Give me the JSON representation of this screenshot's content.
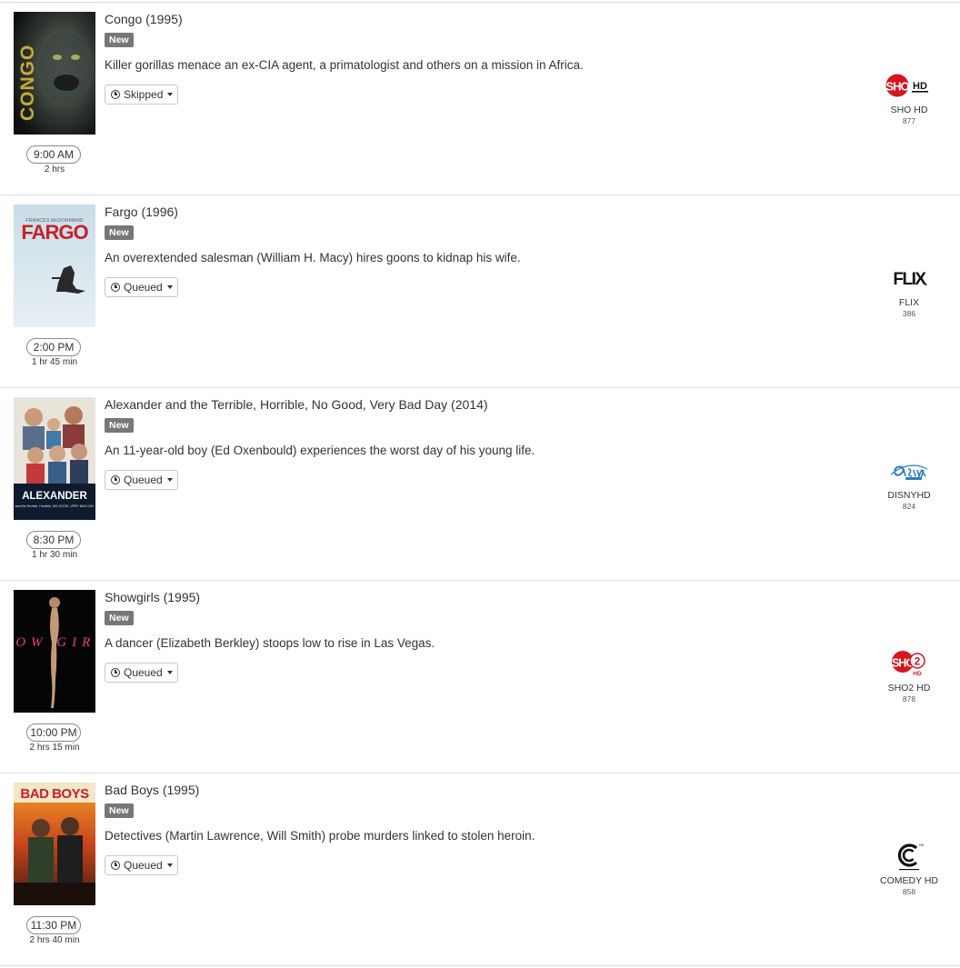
{
  "listings": [
    {
      "title": "Congo (1995)",
      "badge": "New",
      "description": "Killer gorillas menace an ex-CIA agent, a primatologist and others on a mission in Africa.",
      "status": "Skipped",
      "time": "9:00 AM",
      "duration": "2 hrs",
      "poster_text": "CONGO",
      "channel": {
        "name": "SHO HD",
        "number": "877",
        "logo": "sho-hd-logo"
      }
    },
    {
      "title": "Fargo (1996)",
      "badge": "New",
      "description": "An overextended salesman (William H. Macy) hires goons to kidnap his wife.",
      "status": "Queued",
      "time": "2:00 PM",
      "duration": "1 hr 45 min",
      "poster_text": "FARGO",
      "poster_subtext": "FRANCES McDORMAND",
      "channel": {
        "name": "FLIX",
        "number": "386",
        "logo": "flix-logo"
      }
    },
    {
      "title": "Alexander and the Terrible, Horrible, No Good, Very Bad Day (2014)",
      "badge": "New",
      "description": "An 11-year-old boy (Ed Oxenbould) experiences the worst day of his young life.",
      "status": "Queued",
      "time": "8:30 PM",
      "duration": "1 hr 30 min",
      "poster_text": "ALEXANDER",
      "poster_subtext": "and the Terrible, Horrible, NO GOOD, VERY BAD DAY",
      "channel": {
        "name": "DISNYHD",
        "number": "824",
        "logo": "disney-channel-logo"
      }
    },
    {
      "title": "Showgirls (1995)",
      "badge": "New",
      "description": "A dancer (Elizabeth Berkley) stoops low to rise in Las Vegas.",
      "status": "Queued",
      "time": "10:00 PM",
      "duration": "2 hrs 15 min",
      "poster_text": "SHOW GIRLS",
      "channel": {
        "name": "SHO2 HD",
        "number": "878",
        "logo": "sho2-hd-logo"
      }
    },
    {
      "title": "Bad Boys (1995)",
      "badge": "New",
      "description": "Detectives (Martin Lawrence, Will Smith) probe murders linked to stolen heroin.",
      "status": "Queued",
      "time": "11:30 PM",
      "duration": "2 hrs 40 min",
      "poster_text": "BAD BOYS",
      "channel": {
        "name": "COMEDY HD",
        "number": "858",
        "logo": "comedy-central-logo"
      }
    }
  ],
  "colors": {
    "badge_bg": "#777777",
    "divider": "#dddddd",
    "showtime_red": "#d6161f"
  }
}
